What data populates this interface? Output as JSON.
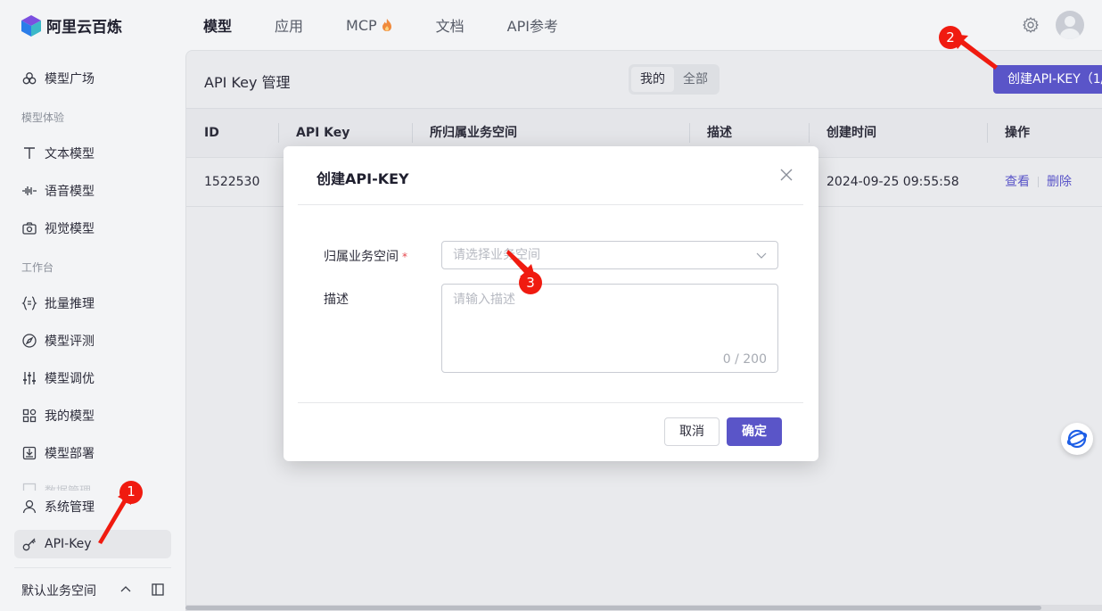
{
  "app": {
    "logo_text": "阿里云百炼"
  },
  "topnav": [
    {
      "label": "模型",
      "active": true
    },
    {
      "label": "应用",
      "active": false
    },
    {
      "label": "MCP",
      "active": false,
      "icon": "fire-icon"
    },
    {
      "label": "文档",
      "active": false
    },
    {
      "label": "API参考",
      "active": false
    }
  ],
  "sidebar": {
    "items": [
      {
        "label": "模型广场",
        "icon": "model-plaza-icon"
      },
      {
        "label": "文本模型",
        "icon": "text-icon"
      },
      {
        "label": "语音模型",
        "icon": "audio-wave-icon"
      },
      {
        "label": "视觉模型",
        "icon": "camera-icon"
      },
      {
        "label": "批量推理",
        "icon": "braces-icon"
      },
      {
        "label": "模型评测",
        "icon": "compass-icon"
      },
      {
        "label": "模型调优",
        "icon": "sliders-icon"
      },
      {
        "label": "我的模型",
        "icon": "grid-icon"
      },
      {
        "label": "模型部署",
        "icon": "deploy-icon"
      },
      {
        "label": "数据管理",
        "icon": "data-icon"
      },
      {
        "label": "系统管理",
        "icon": "user-icon"
      },
      {
        "label": "API-Key",
        "icon": "key-icon",
        "active": true
      }
    ],
    "groups": {
      "experience": "模型体验",
      "workbench": "工作台"
    },
    "workspace": "默认业务空间"
  },
  "main": {
    "title": "API Key 管理",
    "segments": [
      {
        "label": "我的",
        "active": true
      },
      {
        "label": "全部",
        "active": false
      }
    ],
    "create_button": "创建API-KEY（1/"
  },
  "table": {
    "columns": [
      "ID",
      "API Key",
      "所归属业务空间",
      "描述",
      "创建时间",
      "操作"
    ],
    "rows": [
      {
        "id": "1522530",
        "created": "2024-09-25 09:55:58",
        "actions": [
          "查看",
          "删除"
        ]
      }
    ]
  },
  "modal": {
    "title": "创建API-KEY",
    "workspace_label": "归属业务空间",
    "required_mark": "*",
    "workspace_placeholder": "请选择业务空间",
    "desc_label": "描述",
    "desc_placeholder": "请输入描述",
    "desc_count": "0 / 200",
    "cancel": "取消",
    "ok": "确定"
  },
  "annotations": [
    "1",
    "2",
    "3"
  ],
  "colors": {
    "primary": "#5a55c8",
    "annotation": "#f01b10",
    "required": "#e5484d"
  }
}
